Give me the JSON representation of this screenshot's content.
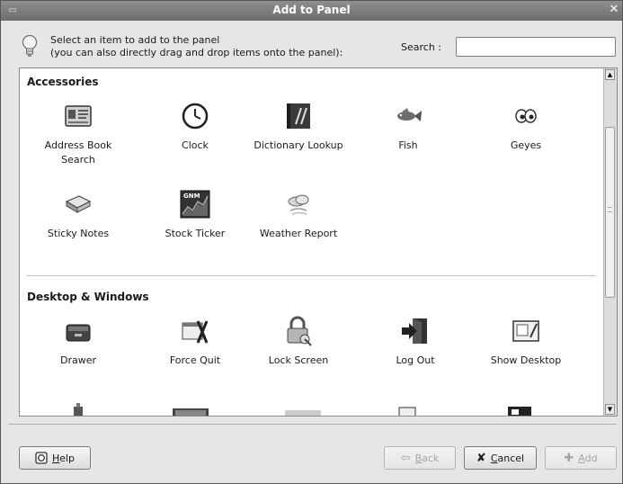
{
  "window": {
    "title": "Add to Panel",
    "menu_glyph": "▭",
    "close_glyph": "✕"
  },
  "hint": {
    "line1": "Select an item to add to the panel",
    "line2": "(you can also directly drag and drop items onto the panel):",
    "icon": "lightbulb-icon"
  },
  "search": {
    "label": "Search :",
    "value": "",
    "placeholder": ""
  },
  "sections": [
    {
      "title": "Accessories",
      "items": [
        {
          "label": "Address Book Search",
          "line1": "Address Book",
          "line2": "Search",
          "icon": "address-book-icon"
        },
        {
          "label": "Clock",
          "icon": "clock-icon"
        },
        {
          "label": "Dictionary Lookup",
          "icon": "dictionary-icon"
        },
        {
          "label": "Fish",
          "icon": "fish-icon"
        },
        {
          "label": "Geyes",
          "icon": "eyes-icon"
        },
        {
          "label": "Sticky Notes",
          "icon": "sticky-notes-icon"
        },
        {
          "label": "Stock Ticker",
          "icon": "stock-ticker-icon",
          "badge": "GNM"
        },
        {
          "label": "Weather Report",
          "icon": "weather-icon"
        }
      ]
    },
    {
      "title": "Desktop & Windows",
      "items": [
        {
          "label": "Drawer",
          "icon": "drawer-icon"
        },
        {
          "label": "Force Quit",
          "icon": "force-quit-icon"
        },
        {
          "label": "Lock Screen",
          "icon": "lock-icon"
        },
        {
          "label": "Log Out",
          "icon": "logout-icon"
        },
        {
          "label": "Show Desktop",
          "icon": "show-desktop-icon"
        }
      ]
    }
  ],
  "buttons": {
    "help": {
      "label_u": "H",
      "label_rest": "elp",
      "icon": "help-icon"
    },
    "back": {
      "label_u": "B",
      "label_rest": "ack",
      "icon": "back-arrow-icon",
      "enabled": false
    },
    "cancel": {
      "label_u": "C",
      "label_rest": "ancel",
      "icon": "cancel-x-icon"
    },
    "add": {
      "label_u": "A",
      "label_rest": "dd",
      "icon": "add-plus-icon",
      "enabled": false
    }
  },
  "colors": {
    "titlebar": "#7a7a7a",
    "list_bg": "#ffffff",
    "window_bg": "#e6e6e6"
  }
}
